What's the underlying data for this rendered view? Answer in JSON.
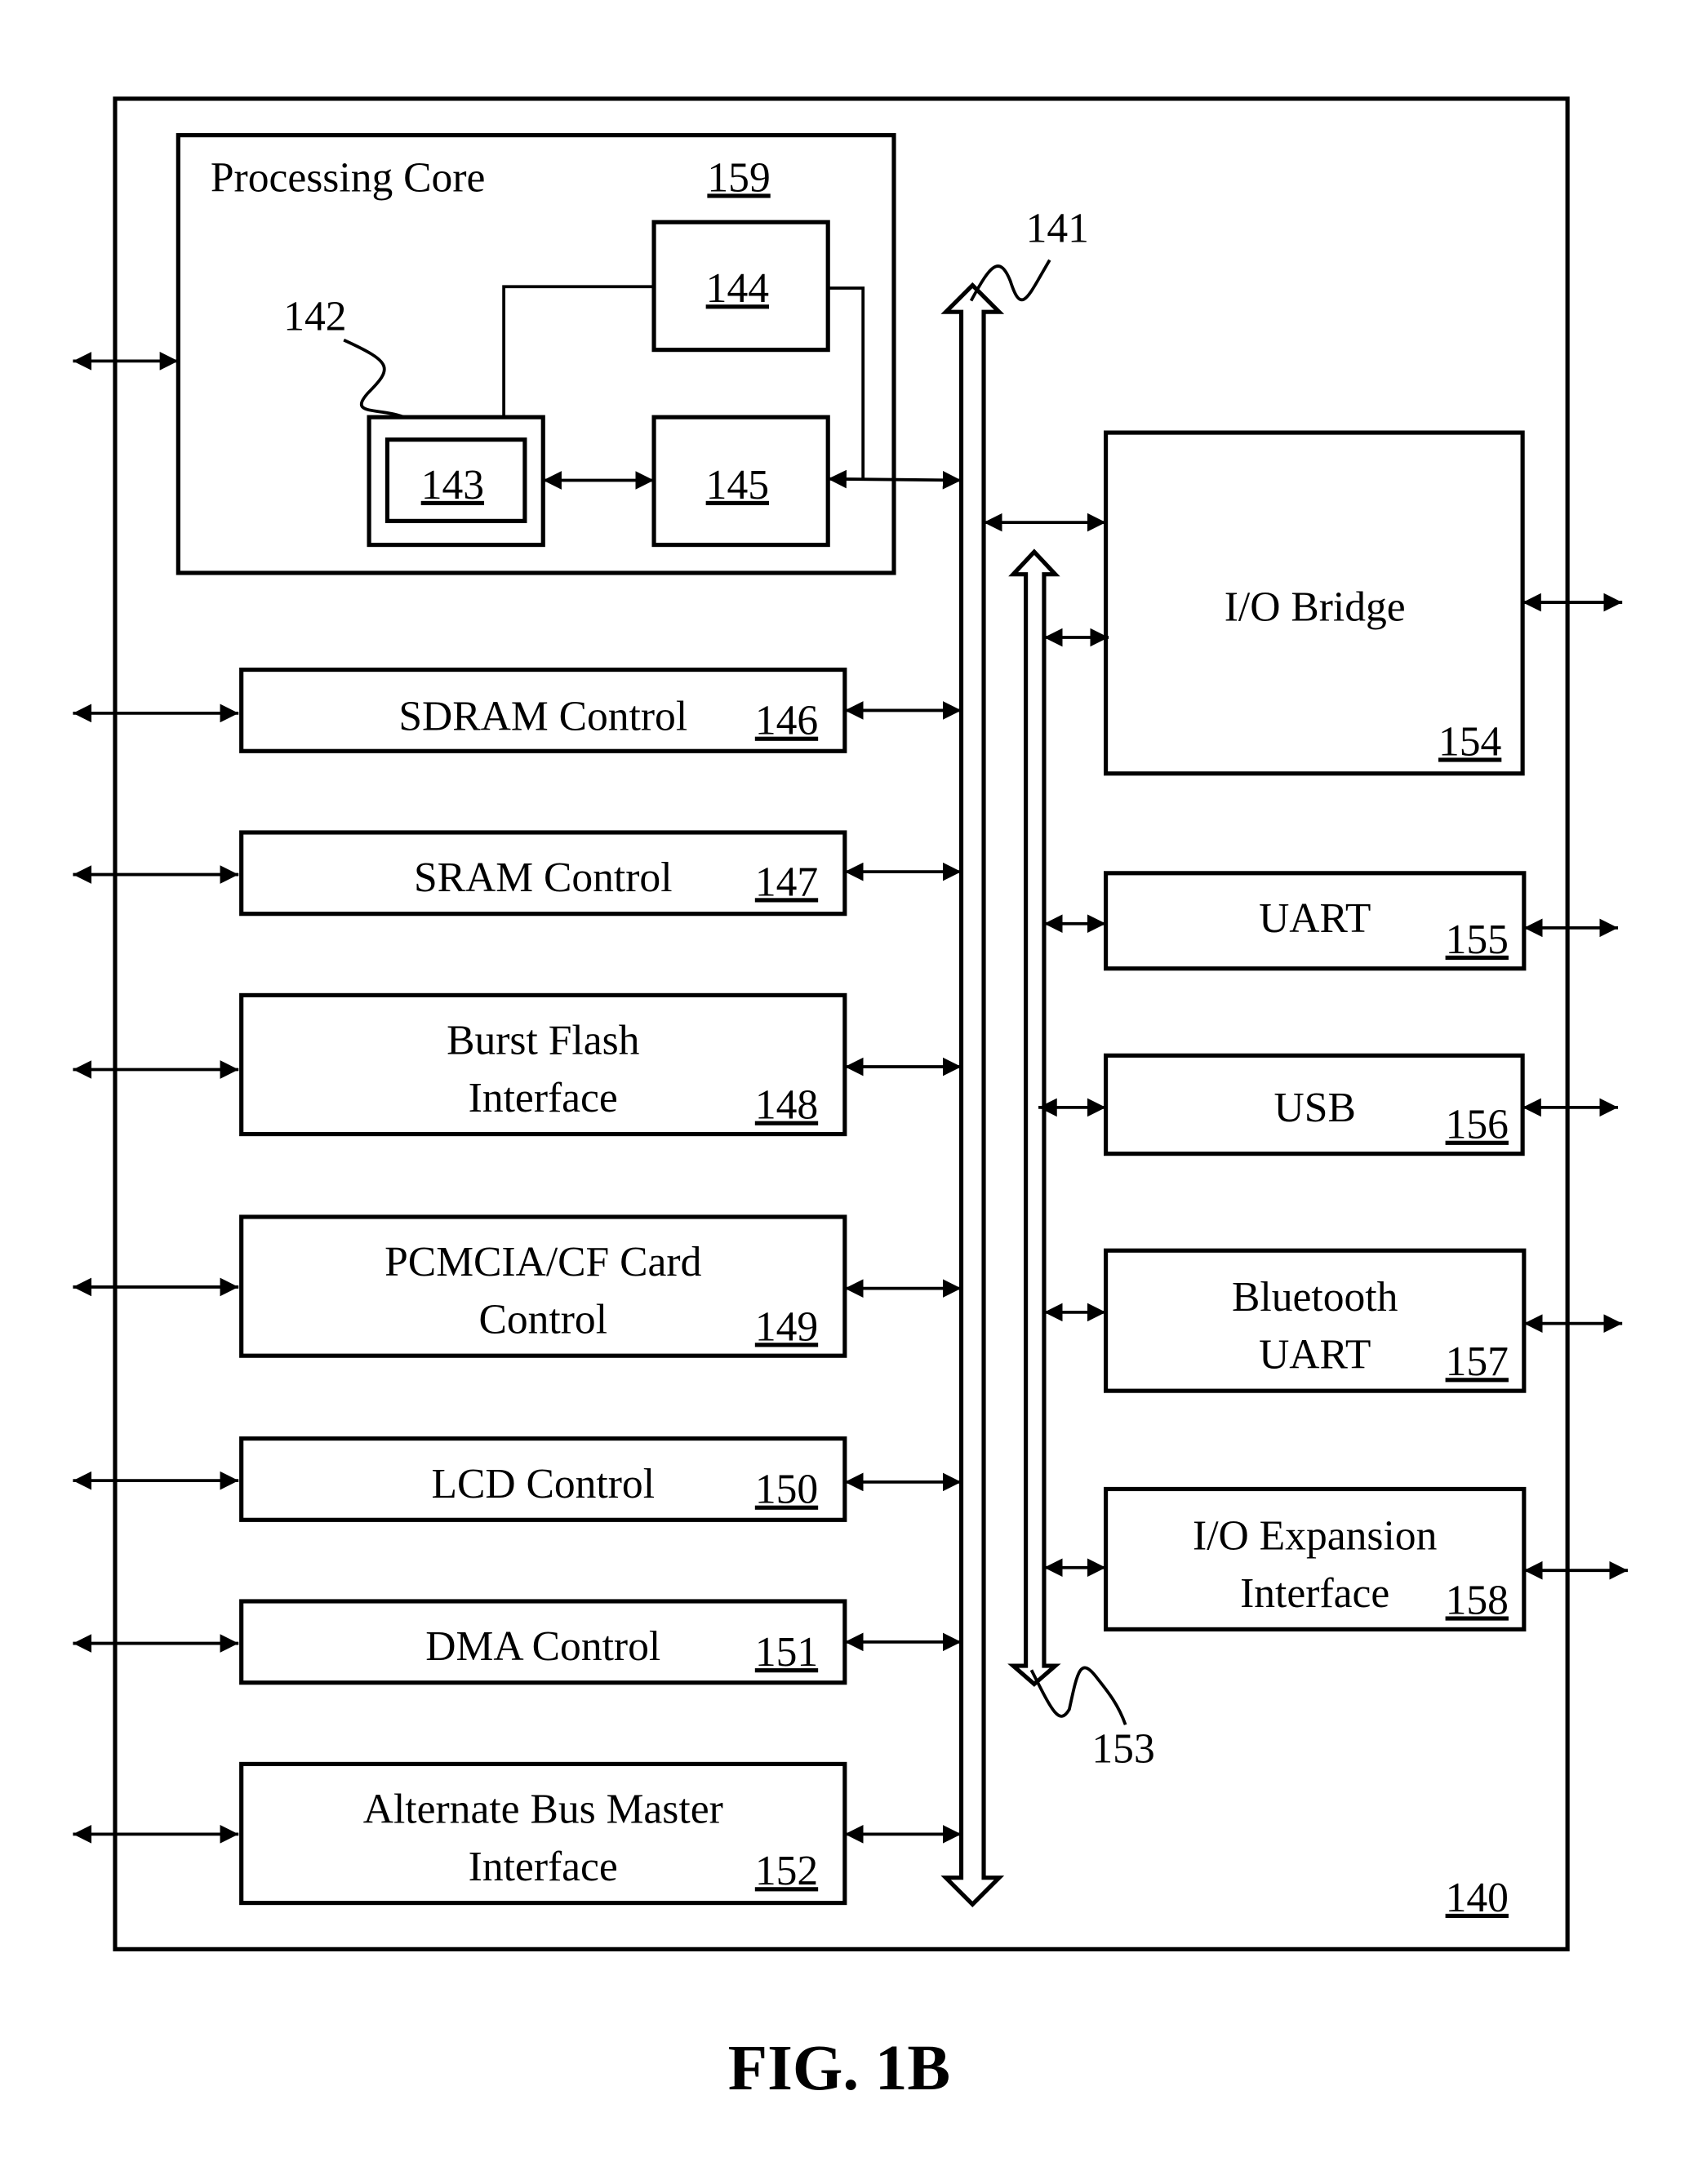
{
  "figure": {
    "caption": "FIG. 1B",
    "system_ref": "140"
  },
  "processing_core": {
    "label": "Processing Core",
    "ref": "159",
    "blocks": {
      "b142": "142",
      "b143": "143",
      "b144": "144",
      "b145": "145"
    }
  },
  "buses": {
    "main_bus_ref": "141",
    "secondary_bus_ref": "153"
  },
  "left_blocks": [
    {
      "lines": [
        "SDRAM Control"
      ],
      "ref": "146"
    },
    {
      "lines": [
        "SRAM Control"
      ],
      "ref": "147"
    },
    {
      "lines": [
        "Burst Flash",
        "Interface"
      ],
      "ref": "148"
    },
    {
      "lines": [
        "PCMCIA/CF Card",
        "Control"
      ],
      "ref": "149"
    },
    {
      "lines": [
        "LCD Control"
      ],
      "ref": "150"
    },
    {
      "lines": [
        "DMA Control"
      ],
      "ref": "151"
    },
    {
      "lines": [
        "Alternate Bus Master",
        "Interface"
      ],
      "ref": "152"
    }
  ],
  "right_blocks": [
    {
      "lines": [
        "I/O Bridge"
      ],
      "ref": "154"
    },
    {
      "lines": [
        "UART"
      ],
      "ref": "155"
    },
    {
      "lines": [
        "USB"
      ],
      "ref": "156"
    },
    {
      "lines": [
        "Bluetooth",
        "UART"
      ],
      "ref": "157"
    },
    {
      "lines": [
        "I/O Expansion",
        "Interface"
      ],
      "ref": "158"
    }
  ]
}
